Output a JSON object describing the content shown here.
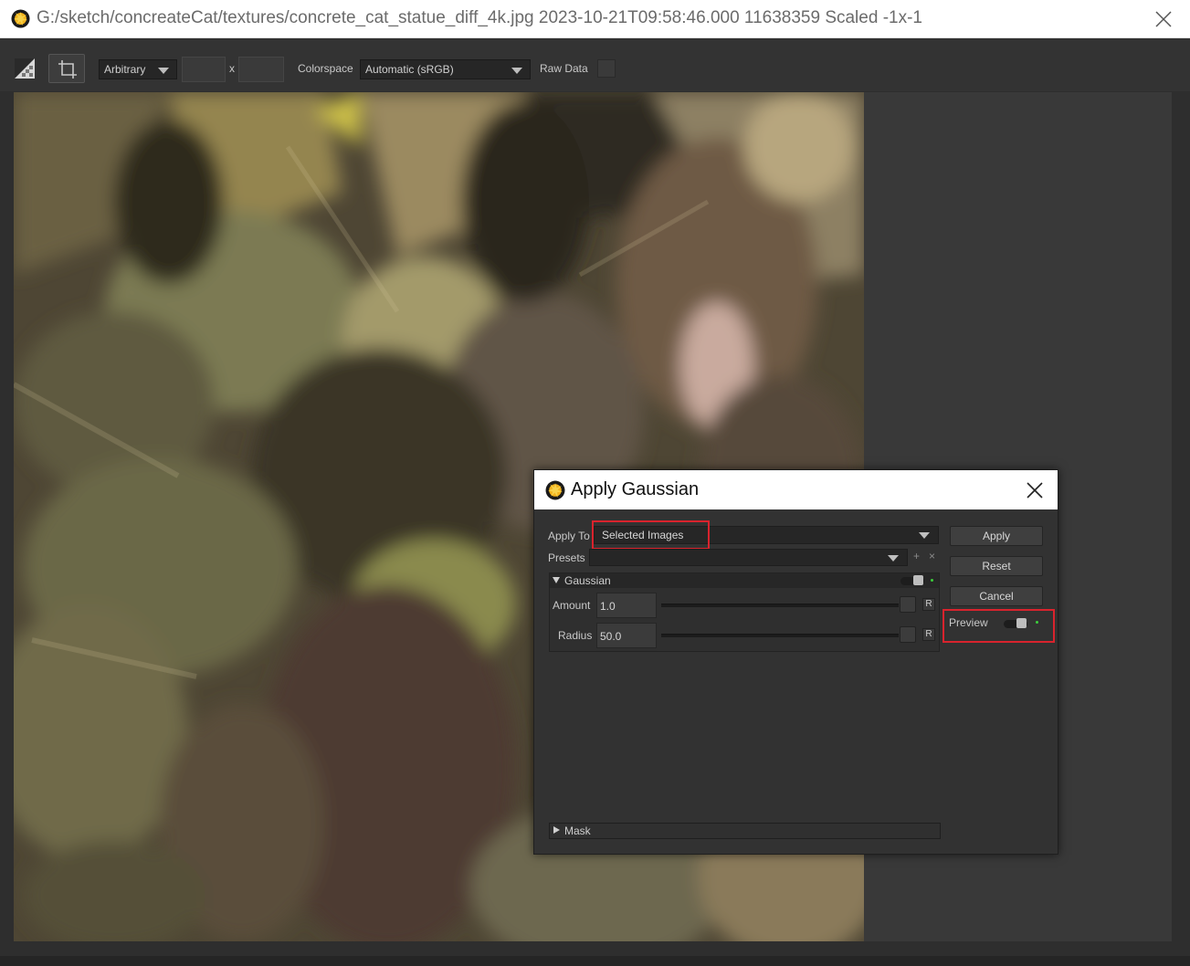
{
  "window": {
    "title": "G:/sketch/concreateCat/textures/concrete_cat_statue_diff_4k.jpg 2023-10-21T09:58:46.000 11638359 Scaled -1x-1"
  },
  "toolbar": {
    "aspect_mode": "Arbitrary",
    "width_value": "",
    "height_value": "",
    "times_symbol": "x",
    "colorspace_label": "Colorspace",
    "colorspace_value": "Automatic (sRGB)",
    "raw_data_label": "Raw Data",
    "raw_data_checked": false
  },
  "dialog": {
    "title": "Apply Gaussian",
    "apply_to_label": "Apply To",
    "apply_to_value": "Selected Images",
    "presets_label": "Presets",
    "presets_value": "",
    "preset_add": "+",
    "preset_remove": "×",
    "group_name": "Gaussian",
    "params": [
      {
        "label": "Amount",
        "value": "1.0",
        "reset": "R"
      },
      {
        "label": "Radius",
        "value": "50.0",
        "reset": "R"
      }
    ],
    "buttons": {
      "apply": "Apply",
      "reset": "Reset",
      "cancel": "Cancel"
    },
    "preview_label": "Preview",
    "mask_label": "Mask",
    "highlight_color": "#d9232d",
    "led_color": "#3ccf3c"
  }
}
